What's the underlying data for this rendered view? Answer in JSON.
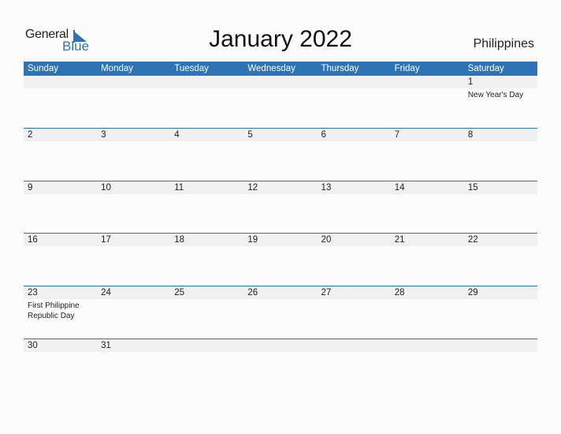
{
  "logo": {
    "general": "General",
    "blue": "Blue"
  },
  "title": "January 2022",
  "country": "Philippines",
  "days": [
    "Sunday",
    "Monday",
    "Tuesday",
    "Wednesday",
    "Thursday",
    "Friday",
    "Saturday"
  ],
  "weeks": [
    [
      {
        "d": ""
      },
      {
        "d": ""
      },
      {
        "d": ""
      },
      {
        "d": ""
      },
      {
        "d": ""
      },
      {
        "d": ""
      },
      {
        "d": "1",
        "h": "New Year's Day"
      }
    ],
    [
      {
        "d": "2"
      },
      {
        "d": "3"
      },
      {
        "d": "4"
      },
      {
        "d": "5"
      },
      {
        "d": "6"
      },
      {
        "d": "7"
      },
      {
        "d": "8"
      }
    ],
    [
      {
        "d": "9"
      },
      {
        "d": "10"
      },
      {
        "d": "11"
      },
      {
        "d": "12"
      },
      {
        "d": "13"
      },
      {
        "d": "14"
      },
      {
        "d": "15"
      }
    ],
    [
      {
        "d": "16"
      },
      {
        "d": "17"
      },
      {
        "d": "18"
      },
      {
        "d": "19"
      },
      {
        "d": "20"
      },
      {
        "d": "21"
      },
      {
        "d": "22"
      }
    ],
    [
      {
        "d": "23",
        "h": "First Philippine Republic Day"
      },
      {
        "d": "24"
      },
      {
        "d": "25"
      },
      {
        "d": "26"
      },
      {
        "d": "27"
      },
      {
        "d": "28"
      },
      {
        "d": "29"
      }
    ],
    [
      {
        "d": "30"
      },
      {
        "d": "31"
      },
      {
        "d": ""
      },
      {
        "d": ""
      },
      {
        "d": ""
      },
      {
        "d": ""
      },
      {
        "d": ""
      }
    ]
  ],
  "colors": {
    "accent": "#2e74b5",
    "band": "#f0f0f0"
  }
}
